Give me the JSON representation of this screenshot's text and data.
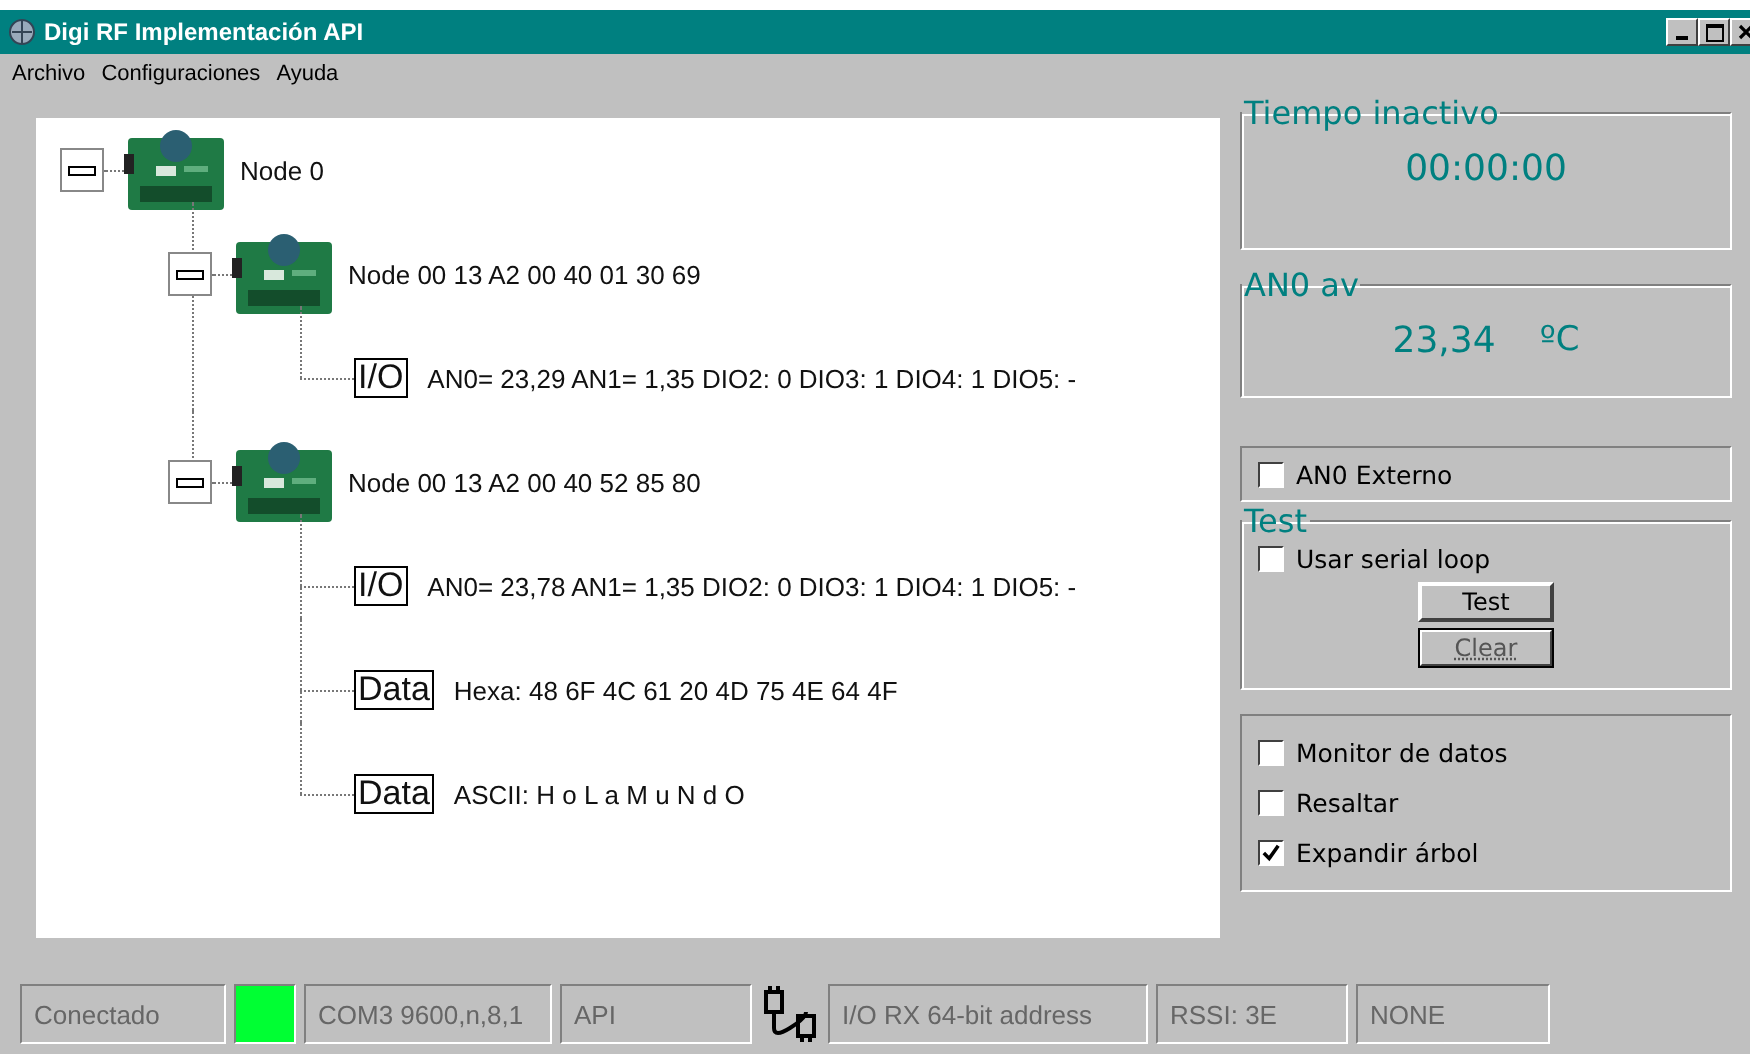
{
  "window": {
    "title": "Digi RF Implementación API"
  },
  "menu": [
    "Archivo",
    "Configuraciones",
    "Ayuda"
  ],
  "tree": [
    {
      "kind": "node",
      "label": "Node 0",
      "expanded": true,
      "children": [
        {
          "kind": "node",
          "label": "Node 00 13 A2 00 40 01 30 69",
          "expanded": true,
          "children": [
            {
              "kind": "leaf",
              "tag": "I/O",
              "text": "AN0= 23,29 AN1= 1,35 DIO2: 0 DIO3: 1 DIO4: 1 DIO5:  -"
            }
          ]
        },
        {
          "kind": "node",
          "label": "Node 00 13 A2 00 40 52 85 80",
          "expanded": true,
          "children": [
            {
              "kind": "leaf",
              "tag": "I/O",
              "text": "AN0= 23,78 AN1= 1,35 DIO2: 0 DIO3: 1 DIO4: 1 DIO5:  -"
            },
            {
              "kind": "leaf",
              "tag": "Data",
              "text": "Hexa: 48 6F 4C 61 20 4D 75 4E 64 4F"
            },
            {
              "kind": "leaf",
              "tag": "Data",
              "text": "ASCII: H o L a  M u N d O"
            }
          ]
        }
      ]
    }
  ],
  "idle_time": {
    "title": "Tiempo inactivo",
    "value": "00:00:00"
  },
  "an0_average": {
    "title": "AN0 av",
    "value": "23,34",
    "unit": "ºC"
  },
  "an0_external": {
    "label": "AN0 Externo",
    "checked": false
  },
  "test": {
    "title": "Test",
    "serial_loop": {
      "label": "Usar serial loop",
      "checked": false
    },
    "buttons": [
      {
        "label": "Test",
        "focused": false
      },
      {
        "label": "Clear",
        "focused": true
      }
    ]
  },
  "options": [
    {
      "label": "Monitor de datos",
      "checked": false
    },
    {
      "label": "Resaltar",
      "checked": false
    },
    {
      "label": "Expandir árbol",
      "checked": true
    }
  ],
  "status_bar": {
    "connection": "Conectado",
    "connected": true,
    "port": "COM3 9600,n,8,1",
    "mode": "API",
    "frame": "I/O RX 64-bit address",
    "rssi": "RSSI: 3E",
    "extra": "NONE"
  }
}
